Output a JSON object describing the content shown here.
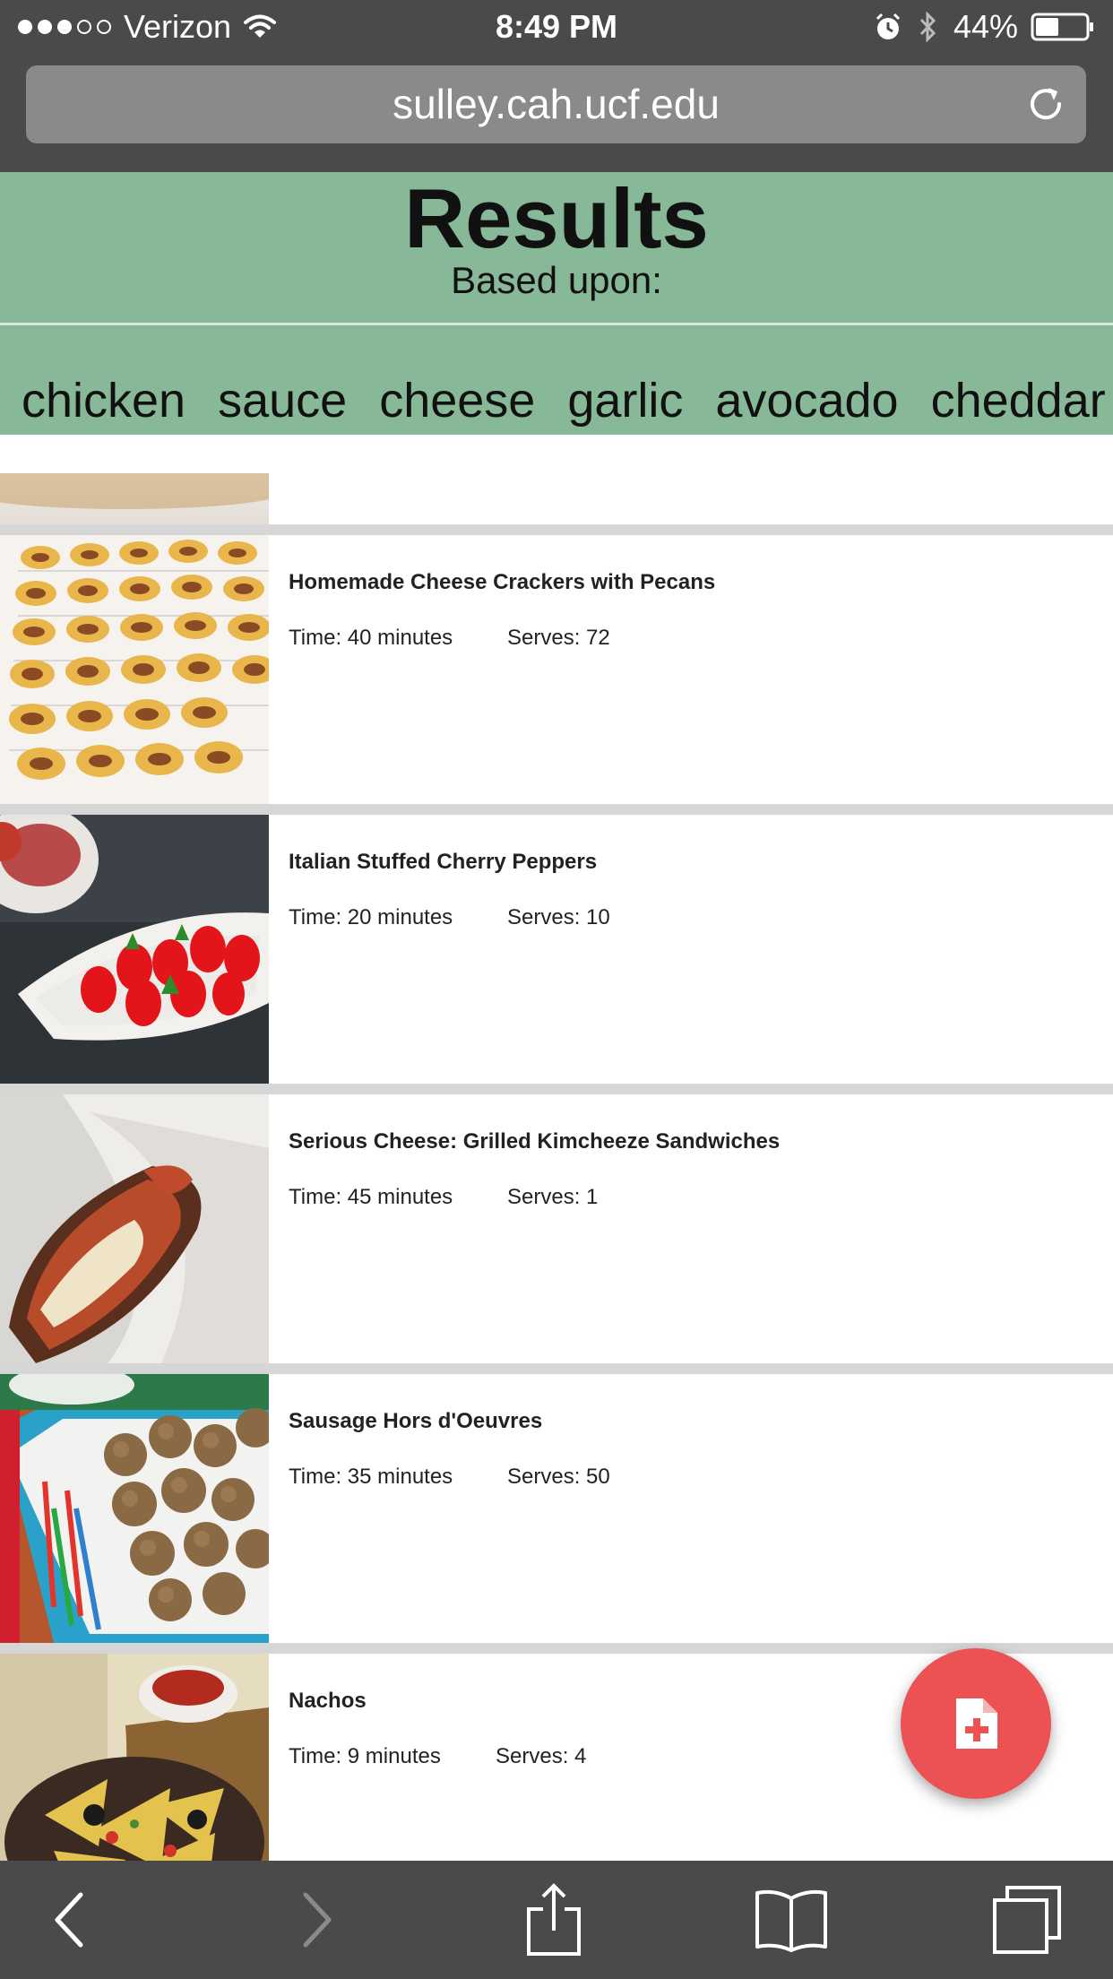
{
  "status_bar": {
    "carrier": "Verizon",
    "signal_bars_filled": 3,
    "signal_bars_total": 5,
    "time": "8:49 PM",
    "battery_percent": "44%",
    "icons": [
      "wifi-icon",
      "alarm-icon",
      "bluetooth-icon",
      "battery-icon"
    ]
  },
  "browser": {
    "url": "sulley.cah.ucf.edu",
    "reload_icon": "reload-icon",
    "toolbar": [
      "back-icon",
      "forward-icon",
      "share-icon",
      "bookmarks-icon",
      "tabs-icon"
    ]
  },
  "header": {
    "title": "Results",
    "subtitle": "Based upon:",
    "background_color": "#87b898"
  },
  "ingredients": [
    "chicken",
    "sauce",
    "cheese",
    "garlic",
    "avocado",
    "cheddar"
  ],
  "recipes": [
    {
      "name": "Homemade Cheese Crackers with Pecans",
      "time": "Time: 40 minutes",
      "serves": "Serves: 72"
    },
    {
      "name": "Italian Stuffed Cherry Peppers",
      "time": "Time: 20 minutes",
      "serves": "Serves: 10"
    },
    {
      "name": "Serious Cheese: Grilled Kimcheeze Sandwiches",
      "time": "Time: 45 minutes",
      "serves": "Serves: 1"
    },
    {
      "name": "Sausage Hors d'Oeuvres",
      "time": "Time: 35 minutes",
      "serves": "Serves: 50"
    },
    {
      "name": "Nachos",
      "time": "Time: 9 minutes",
      "serves": "Serves: 4"
    }
  ],
  "fab": {
    "icon": "add-document-icon",
    "color": "#ec5153"
  }
}
